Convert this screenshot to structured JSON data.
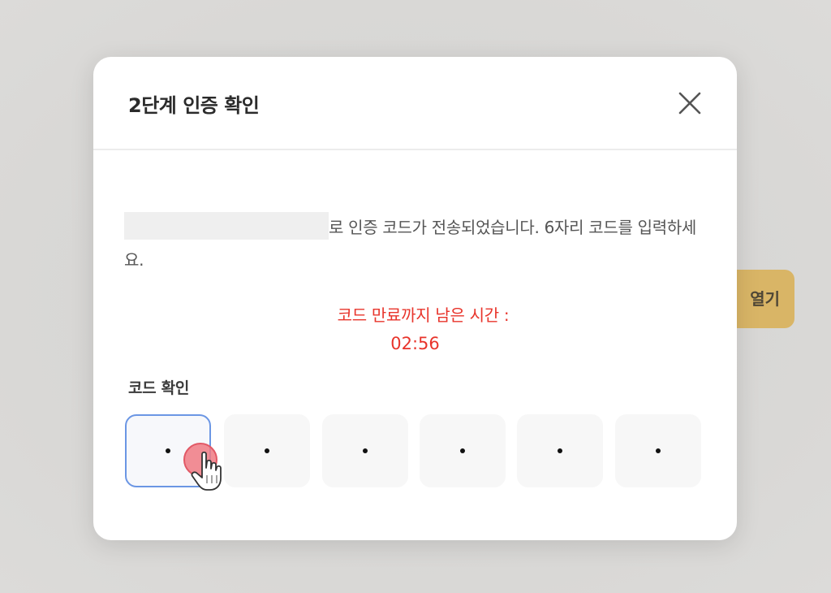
{
  "background": {
    "open_button_label": "열기",
    "accent_color": "#d9b566"
  },
  "modal": {
    "title": "2단계 인증 확인",
    "close_icon": "close-icon",
    "description_rest": "로 인증 코드가 전송되었습니다. 6자리 코드를 입력하세요.",
    "timer_label": "코드 만료까지 남은 시간 :",
    "timer_value": "02:56",
    "timer_color": "#e8342b",
    "code_label": "코드 확인",
    "code_digits": [
      "•",
      "•",
      "•",
      "•",
      "•",
      "•"
    ],
    "active_box_index": 0,
    "active_border_color": "#6b96e4"
  }
}
